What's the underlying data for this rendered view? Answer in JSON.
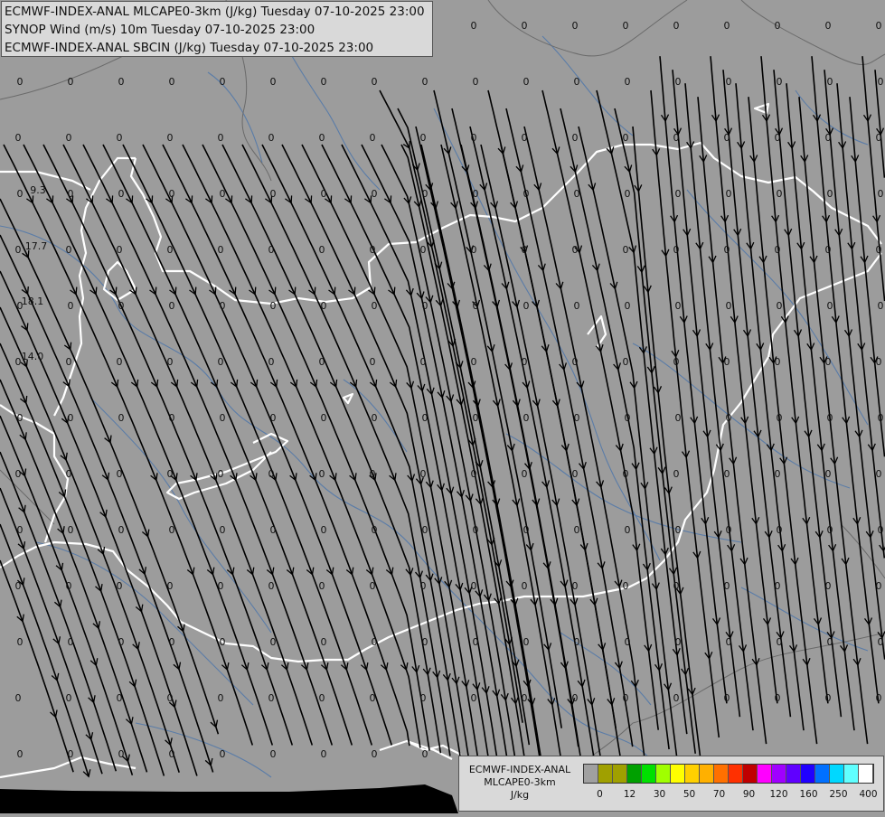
{
  "titles": {
    "line1": "ECMWF-INDEX-ANAL MLCAPE0-3km (J/kg) Tuesday 07-10-2025 23:00",
    "line2": "SYNOP Wind (m/s) 10m Tuesday 07-10-2025 23:00",
    "line3": "ECMWF-INDEX-ANAL SBCIN (J/kg) Tuesday 07-10-2025 23:00"
  },
  "legend": {
    "model": "ECMWF-INDEX-ANAL",
    "field": "MLCAPE0-3km",
    "unit": "J/kg",
    "colors": [
      "#a0a0a0",
      "#a0a000",
      "#a0a000",
      "#00a000",
      "#00e000",
      "#a0ff00",
      "#ffff00",
      "#ffd000",
      "#ffb000",
      "#ff7000",
      "#ff3000",
      "#c00000",
      "#ff00ff",
      "#a000ff",
      "#6000ff",
      "#2000ff",
      "#0070ff",
      "#00d8ff",
      "#60ffff",
      "#ffffff"
    ],
    "ticks": [
      {
        "label": "0",
        "index": 1
      },
      {
        "label": "12",
        "index": 3
      },
      {
        "label": "30",
        "index": 5
      },
      {
        "label": "50",
        "index": 7
      },
      {
        "label": "70",
        "index": 9
      },
      {
        "label": "90",
        "index": 11
      },
      {
        "label": "120",
        "index": 13
      },
      {
        "label": "160",
        "index": 15
      },
      {
        "label": "250",
        "index": 17
      },
      {
        "label": "400",
        "index": 19
      }
    ]
  },
  "cin_values": {
    "other": [
      "9.3",
      "17.7",
      "18.1",
      "14.0"
    ]
  },
  "colors": {
    "map_background": "#9c9c9c",
    "country_border": "#ffffff",
    "rivers": "#5a7ca8",
    "streamlines": "#000000",
    "panel": "#d9d9d9"
  }
}
